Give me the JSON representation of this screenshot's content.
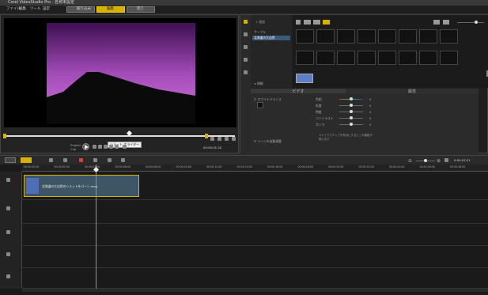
{
  "window": {
    "title": "Corel VideoStudio Pro - 名称未設定"
  },
  "menu": [
    "ファイル",
    "編集",
    "ツール",
    "設定"
  ],
  "steps": [
    {
      "label": "取り込み"
    },
    {
      "label": "編集"
    },
    {
      "label": "完了"
    }
  ],
  "preview": {
    "timecode": "00:00:01:20",
    "project_label": "Project",
    "clip_label": "Clip",
    "tooltip": "ショット スライダー"
  },
  "library": {
    "add_label": "追加",
    "folders": [
      "サンプル",
      "北海道の大自然"
    ],
    "thumb_count": 16
  },
  "options": {
    "tab_video": "ビデオ",
    "tab_attribute": "属性",
    "white_balance": "ホワイトバランス",
    "auto_tone": "トーンの自動調整",
    "adjust_labels": [
      "色相",
      "彩度",
      "明度",
      "コントラスト",
      "ガンマ"
    ],
    "adjust_values": [
      "0",
      "0",
      "0",
      "0",
      "0"
    ],
    "note": "ジャイアステップを有効にするとこの機能が使えます"
  },
  "timeline": {
    "timecode": "0:00:01:21",
    "ruler": [
      "00:00:00:00",
      "00:00:02:00",
      "00:00:04:00",
      "00:00:06:00",
      "00:00:08:00",
      "00:00:10:00",
      "00:00:12:00",
      "00:00:14:00",
      "00:00:16:00",
      "00:00:18:00",
      "00:00:20:00",
      "00:00:22:00",
      "00:00:24:00",
      "00:00:26:00",
      "00:00:28:00"
    ],
    "clip_name": "北海道の大自然のショットをパーン.mpg"
  },
  "colors": {
    "accent": "#d8b100",
    "playhead": "#3fb7c0"
  }
}
